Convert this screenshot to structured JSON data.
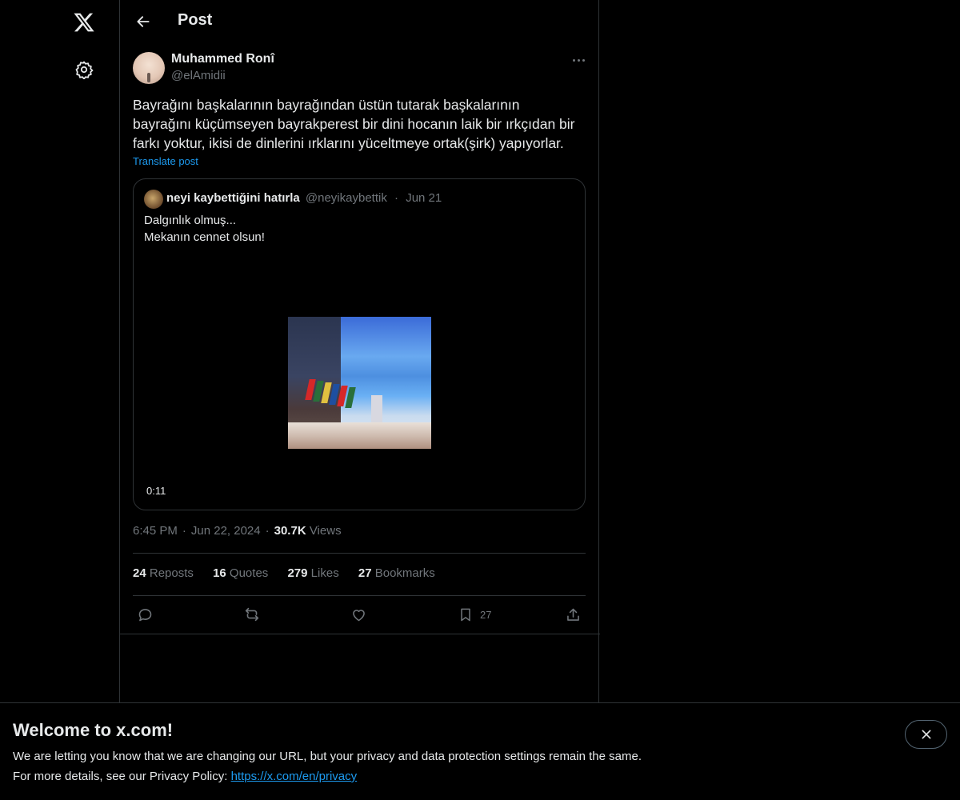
{
  "nav": {
    "logo_icon": "x-logo-icon",
    "settings_icon": "gear-icon"
  },
  "header": {
    "back_icon": "arrow-left-icon",
    "title": "Post"
  },
  "post": {
    "author_name": "Muhammed Ronî",
    "author_handle": "@elAmidii",
    "text_lines": [
      "Bayrağını başkalarının bayrağından üstün tutarak başkalarının",
      "bayrağını küçümseyen bayrakperest bir dini hocanın laik bir ırkçıdan bir",
      "farkı yoktur, ikisi de dinlerini ırklarını yüceltmeye ortak(şirk) yapıyorlar."
    ],
    "translate_label": "Translate post",
    "time": "6:45 PM",
    "date": "Jun 22, 2024",
    "views_count": "30.7K",
    "views_label": "Views"
  },
  "quote": {
    "name": "neyi kaybettiğini hatırla",
    "handle": "@neyikaybettik",
    "date": "Jun 21",
    "text_lines": [
      "Dalgınlık olmuş...",
      "Mekanın cennet olsun!"
    ],
    "video_duration": "0:11"
  },
  "stats": {
    "reposts_count": "24",
    "reposts_label": "Reposts",
    "quotes_count": "16",
    "quotes_label": "Quotes",
    "likes_count": "279",
    "likes_label": "Likes",
    "bookmarks_count": "27",
    "bookmarks_label": "Bookmarks"
  },
  "actions": {
    "reply_icon": "reply-icon",
    "repost_icon": "repost-icon",
    "like_icon": "heart-icon",
    "bookmark_icon": "bookmark-icon",
    "bookmark_count": "27",
    "share_icon": "share-icon"
  },
  "banner": {
    "title": "Welcome to x.com!",
    "line1": "We are letting you know that we are changing our URL, but your privacy and data protection settings remain the same.",
    "line2_prefix": "For more details, see our Privacy Policy: ",
    "link_text": "https://x.com/en/privacy",
    "close_icon": "close-icon"
  },
  "colors": {
    "background": "#000000",
    "text": "#e7e9ea",
    "muted": "#71767b",
    "accent": "#1d9bf0",
    "border": "#2f3336"
  }
}
